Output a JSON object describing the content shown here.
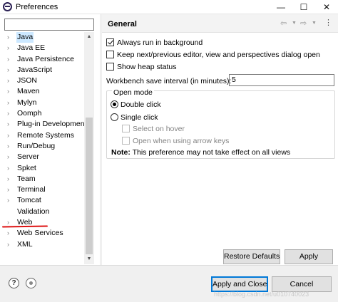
{
  "window": {
    "title": "Preferences",
    "minimize": "—",
    "maximize": "☐",
    "close": "✕"
  },
  "sidebar": {
    "filter_value": "",
    "items": [
      {
        "label": "Java",
        "selected": true
      },
      {
        "label": "Java EE"
      },
      {
        "label": "Java Persistence"
      },
      {
        "label": "JavaScript"
      },
      {
        "label": "JSON"
      },
      {
        "label": "Maven"
      },
      {
        "label": "Mylyn"
      },
      {
        "label": "Oomph"
      },
      {
        "label": "Plug-in Development"
      },
      {
        "label": "Remote Systems"
      },
      {
        "label": "Run/Debug"
      },
      {
        "label": "Server"
      },
      {
        "label": "Spket"
      },
      {
        "label": "Team"
      },
      {
        "label": "Terminal"
      },
      {
        "label": "Tomcat"
      },
      {
        "label": "Validation",
        "leaf": true
      },
      {
        "label": "Web"
      },
      {
        "label": "Web Services"
      },
      {
        "label": "XML"
      }
    ]
  },
  "page": {
    "title": "General",
    "options": {
      "always_run": {
        "label": "Always run in background",
        "checked": true
      },
      "keep_next": {
        "label": "Keep next/previous editor, view and perspectives dialog open",
        "checked": false
      },
      "heap_status": {
        "label": "Show heap status",
        "checked": false
      }
    },
    "interval": {
      "label": "Workbench save interval (in minutes):",
      "value": "5"
    },
    "open_mode": {
      "title": "Open mode",
      "double_click": "Double click",
      "single_click": "Single click",
      "select_on_hover": "Select on hover",
      "open_arrow_keys": "Open when using arrow keys",
      "note_label": "Note:",
      "note_text": " This preference may not take effect on all views"
    },
    "restore_defaults": "Restore Defaults",
    "apply": "Apply"
  },
  "footer": {
    "apply_and_close": "Apply and Close",
    "cancel": "Cancel",
    "watermark": "https://blog.csdn.net/u010740023"
  },
  "colors": {
    "selection": "#cce8ff",
    "focus": "#0078d7",
    "annotation": "#dd1111"
  }
}
